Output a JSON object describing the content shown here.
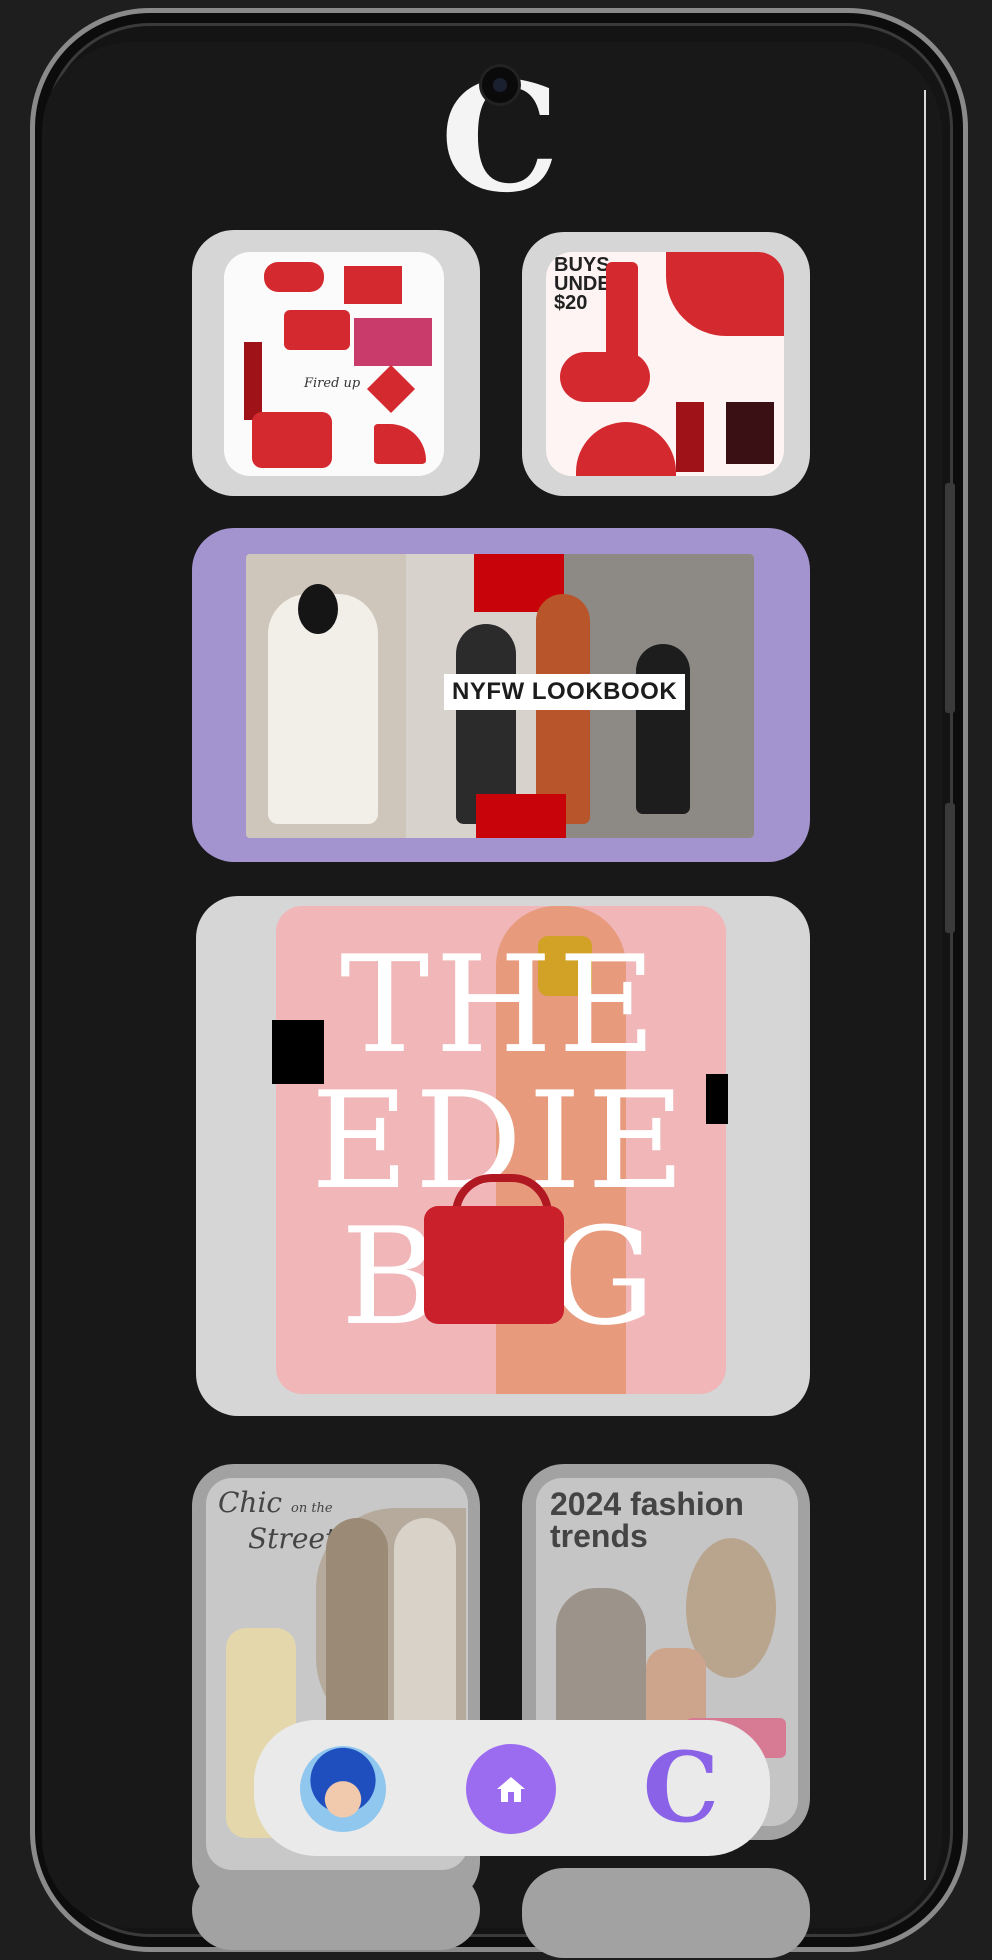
{
  "app": {
    "logo_letter": "C"
  },
  "feed": {
    "lookbook_label": "NYFW LOOKBOOK",
    "makeup_headline": "BUYS UNDER $20",
    "edie_bag_lines": [
      "THE",
      "EDIE",
      "BAG"
    ],
    "chic_title_line1": "Chic",
    "chic_title_line2": "Street",
    "chic_title_small": "on the",
    "trends_title_line1": "2024 fashion",
    "trends_title_line2": "trends",
    "accessories_caption": "Fired up"
  },
  "nav": {
    "items": [
      {
        "name": "profile",
        "icon": "avatar-icon"
      },
      {
        "name": "home",
        "icon": "home-icon"
      },
      {
        "name": "brand",
        "icon": "brand-logo-icon"
      }
    ],
    "brand_letter": "C"
  },
  "colors": {
    "background": "#181818",
    "card_gray": "#d6d6d6",
    "lookbook_purple": "#a393cf",
    "accent_purple": "#9c6cf0",
    "red": "#d42a2f"
  }
}
